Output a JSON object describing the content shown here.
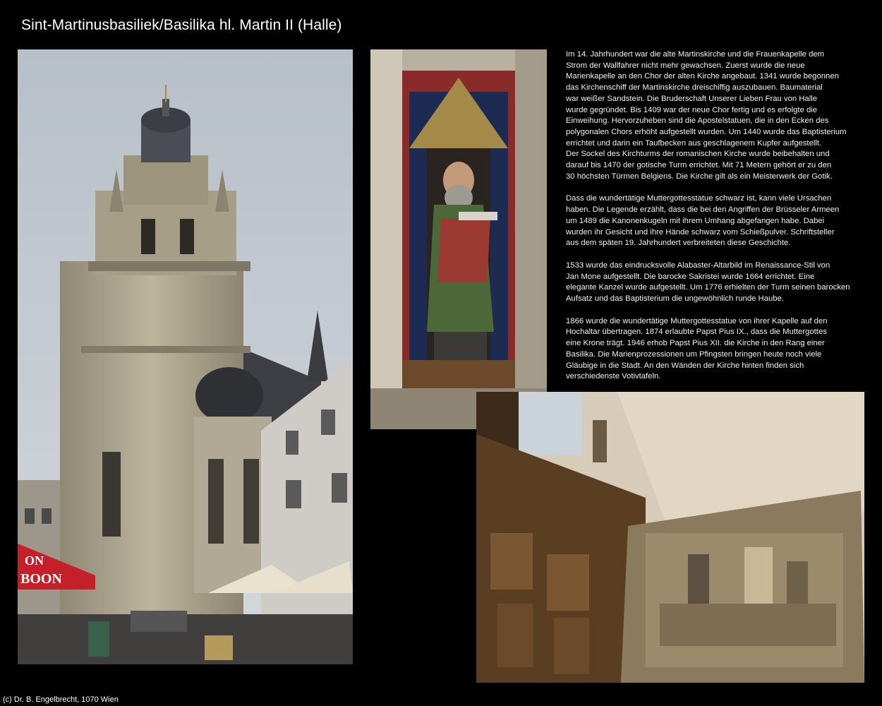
{
  "page": {
    "title": "Sint-Martinusbasiliek/Basilika hl. Martin II (Halle)",
    "copyright": "(c) Dr. B. Engelbrecht, 1070 Wien"
  },
  "photos": {
    "tower": {
      "umbrella_text_1": "ON",
      "umbrella_text_2": "BOON"
    },
    "statue": {},
    "interior": {}
  },
  "text": {
    "paragraphs": [
      "Im 14. Jahrhundert war die alte Martinskirche und die Frauenkapelle dem\nStrom der Wallfahrer nicht mehr gewachsen. Zuerst wurde die neue\nMarienkapelle an den Chor der alten Kirche angebaut. 1341 wurde begonnen\ndas Kirchenschiff der Martinskirche dreischiffig auszubauen. Baumaterial\nwar weißer Sandstein. Die Bruderschaft Unserer Lieben Frau von Halle\nwurde gegründet. Bis 1409 war der neue Chor fertig und es erfolgte die\nEinweihung. Hervorzuheben sind die Apostelstatuen, die in den Ecken des\npolygonalen Chors erhöht aufgestellt wurden. Um 1440 wurde das Baptisterium\nerrichtet und darin ein Taufbecken aus geschlagenem Kupfer aufgestellt.\nDer Sockel des Kirchturms der romanischen Kirche wurde beibehalten und\ndarauf bis 1470 der gotische Turm errichtet. Mit 71 Metern gehört er zu den\n30 höchsten Türmen Belgiens. Die Kirche gilt als ein Meisterwerk der Gotik.",
      "Dass die wundertätige Muttergottesstatue schwarz ist, kann viele Ursachen\nhaben. Die Legende erzählt, dass die bei den Angriffen der Brüsseler Armeen\num 1489 die Kanonenkugeln mit ihrem Umhang abgefangen habe. Dabei\nwurden ihr Gesicht und ihre Hände schwarz vom Schießpulver. Schriftsteller\naus dem späten 19. Jahrhundert verbreiteten diese Geschichte.",
      "1533 wurde das eindrucksvolle Alabaster-Altarbild im Renaissance-Stil von\nJan Mone aufgestellt. Die barocke Sakristei wurde 1664 errichtet. Eine\nelegante Kanzel wurde aufgestellt. Um 1776 erhielten der Turm seinen barocken\nAufsatz und das Baptisterium die ungewöhnlich runde Haube.",
      "1866 wurde die wundertätige Muttergottesstatue von ihrer Kapelle auf den\nHochaltar übertragen. 1874 erlaubte Papst Pius IX., dass die Muttergottes\neine Krone trägt. 1946 erhob Papst Pius XII. die Kirche in den Rang einer\nBasilika. Die Marienprozessionen um Pfingsten bringen heute noch viele\nGläubige in die Stadt. An den Wänden der Kirche hinten finden sich\nverschiedenste Votivtafeln."
    ]
  },
  "colors": {
    "background": "#000000",
    "text": "#ffffff",
    "umbrella_red": "#c4202a"
  }
}
